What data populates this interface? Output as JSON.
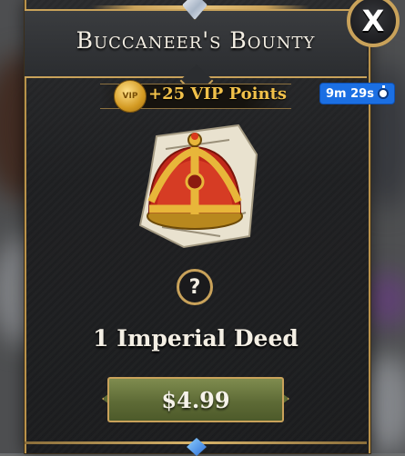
{
  "popup": {
    "title": "Buccaneer's Bounty",
    "close_label": "X",
    "vip": {
      "coin_label": "VIP",
      "text": "+25 VIP Points"
    },
    "timer": "9m 29s",
    "help_label": "?",
    "item_name": "1 Imperial Deed",
    "price": "$4.99"
  },
  "icons": {
    "item": "crown-on-scroll-icon",
    "timer": "stopwatch-icon",
    "vip": "vip-coin-icon"
  },
  "colors": {
    "accent_gold": "#c9a25a",
    "vip_text": "#f1c14a",
    "timer_bg": "#1b6fe3",
    "buy_button": "#5e6b36"
  }
}
